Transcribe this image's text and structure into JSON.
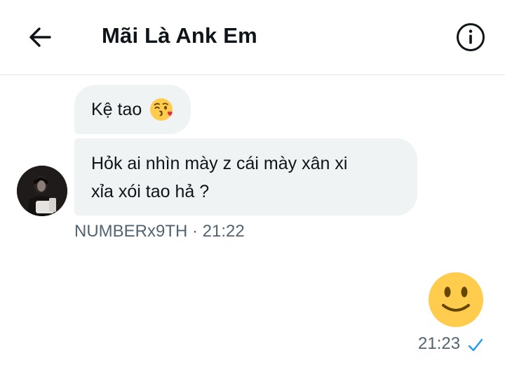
{
  "header": {
    "back_icon": "arrow-left-icon",
    "title": "Mãi Là Ank Em",
    "info_icon": "info-circle-icon"
  },
  "messages": [
    {
      "text": "Kệ tao",
      "emoji": "face-blowing-kiss-emoji",
      "sender": "other"
    },
    {
      "lines": [
        "Hỏk ai nhìn mày z cái mày xân xi",
        "xỉa xói tao hả ?"
      ],
      "sender": "other",
      "meta": "NUMBERx9TH · 21:22"
    },
    {
      "emoji": "slightly-smiling-face-emoji",
      "sender": "me",
      "meta": "21:23",
      "status_icon": "read-check-icon"
    }
  ],
  "colors": {
    "bubble_bg": "#eff3f4",
    "muted_text": "#536471",
    "check_blue": "#1d9bf0",
    "emoji_yellow": "#ffcc4d"
  }
}
